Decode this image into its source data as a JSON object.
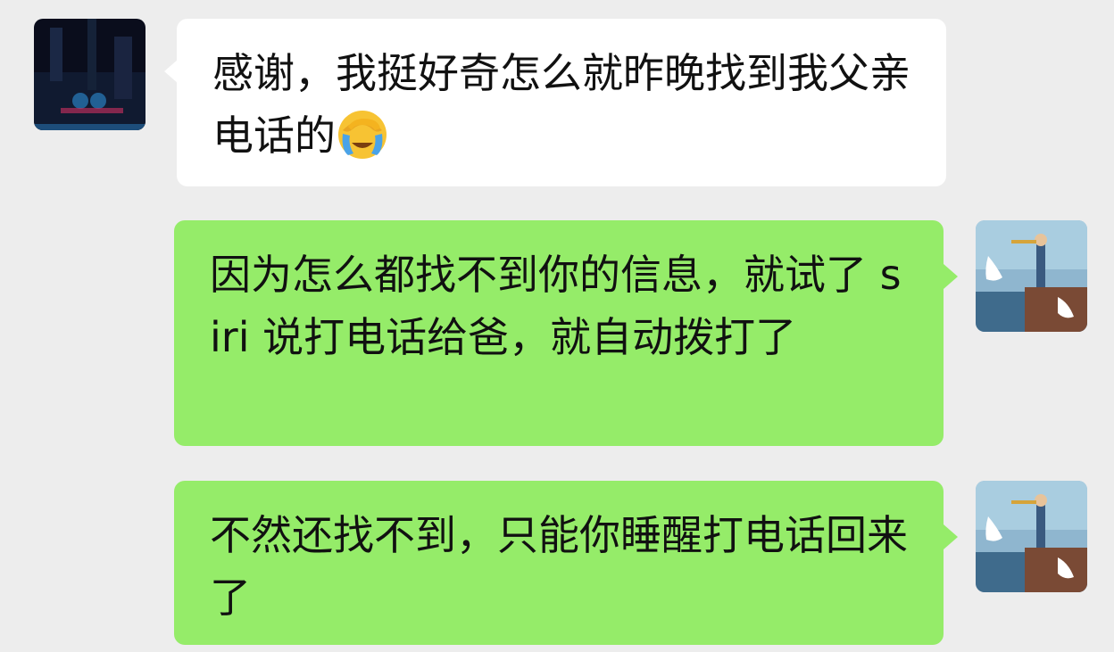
{
  "chat": {
    "messages": [
      {
        "direction": "incoming",
        "text": "感谢，我挺好奇怎么就昨晚找到我父亲电话的",
        "emoji": "face-palm-tears-emoji"
      },
      {
        "direction": "outgoing",
        "text": "因为怎么都找不到你的信息，就试了 siri 说打电话给爸，就自动拨打了"
      },
      {
        "direction": "outgoing",
        "text": "不然还找不到，只能你睡醒打电话回来了"
      }
    ]
  },
  "colors": {
    "background": "#ededed",
    "incoming_bubble": "#ffffff",
    "outgoing_bubble": "#95ec69"
  }
}
